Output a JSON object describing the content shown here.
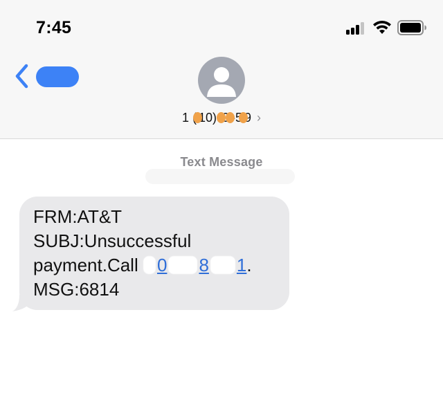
{
  "status_bar": {
    "time": "7:45"
  },
  "nav": {
    "back_icon": "chevron-left-icon",
    "contact_number": {
      "prefix": "1 (",
      "part_a": "10) ",
      "part_b": "0",
      "part_c": "-5",
      "part_d": "9"
    },
    "contact_chevron": "›"
  },
  "thread": {
    "label": "Text Message"
  },
  "message": {
    "line1": "FRM:AT&T",
    "line2": "SUBJ:Unsuccessful",
    "line3_text": "payment.Call",
    "link_parts": [
      "0",
      "8",
      "1"
    ],
    "line3_end": ".",
    "line4": "MSG:6814",
    "bubble_color": "#e9e9eb",
    "link_color": "#2f6ed8"
  },
  "colors": {
    "accent": "#3d82f6",
    "redaction": "#f0a24a"
  }
}
